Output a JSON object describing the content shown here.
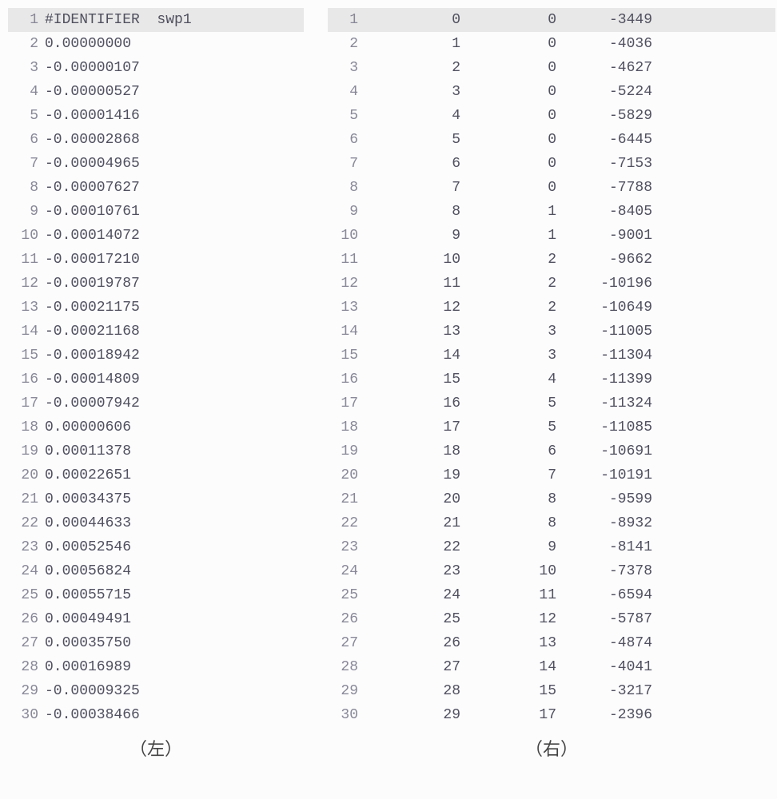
{
  "left_panel": {
    "rows": [
      {
        "n": "1",
        "v": "#IDENTIFIER  swp1",
        "hl": true
      },
      {
        "n": "2",
        "v": "0.00000000"
      },
      {
        "n": "3",
        "v": "-0.00000107"
      },
      {
        "n": "4",
        "v": "-0.00000527"
      },
      {
        "n": "5",
        "v": "-0.00001416"
      },
      {
        "n": "6",
        "v": "-0.00002868"
      },
      {
        "n": "7",
        "v": "-0.00004965"
      },
      {
        "n": "8",
        "v": "-0.00007627"
      },
      {
        "n": "9",
        "v": "-0.00010761"
      },
      {
        "n": "10",
        "v": "-0.00014072"
      },
      {
        "n": "11",
        "v": "-0.00017210"
      },
      {
        "n": "12",
        "v": "-0.00019787"
      },
      {
        "n": "13",
        "v": "-0.00021175"
      },
      {
        "n": "14",
        "v": "-0.00021168"
      },
      {
        "n": "15",
        "v": "-0.00018942"
      },
      {
        "n": "16",
        "v": "-0.00014809"
      },
      {
        "n": "17",
        "v": "-0.00007942"
      },
      {
        "n": "18",
        "v": "0.00000606"
      },
      {
        "n": "19",
        "v": "0.00011378"
      },
      {
        "n": "20",
        "v": "0.00022651"
      },
      {
        "n": "21",
        "v": "0.00034375"
      },
      {
        "n": "22",
        "v": "0.00044633"
      },
      {
        "n": "23",
        "v": "0.00052546"
      },
      {
        "n": "24",
        "v": "0.00056824"
      },
      {
        "n": "25",
        "v": "0.00055715"
      },
      {
        "n": "26",
        "v": "0.00049491"
      },
      {
        "n": "27",
        "v": "0.00035750"
      },
      {
        "n": "28",
        "v": "0.00016989"
      },
      {
        "n": "29",
        "v": "-0.00009325"
      },
      {
        "n": "30",
        "v": "-0.00038466"
      }
    ]
  },
  "right_panel": {
    "rows": [
      {
        "n": "1",
        "c1": "0",
        "c2": "0",
        "c3": "-3449",
        "hl": true
      },
      {
        "n": "2",
        "c1": "1",
        "c2": "0",
        "c3": "-4036"
      },
      {
        "n": "3",
        "c1": "2",
        "c2": "0",
        "c3": "-4627"
      },
      {
        "n": "4",
        "c1": "3",
        "c2": "0",
        "c3": "-5224"
      },
      {
        "n": "5",
        "c1": "4",
        "c2": "0",
        "c3": "-5829"
      },
      {
        "n": "6",
        "c1": "5",
        "c2": "0",
        "c3": "-6445"
      },
      {
        "n": "7",
        "c1": "6",
        "c2": "0",
        "c3": "-7153"
      },
      {
        "n": "8",
        "c1": "7",
        "c2": "0",
        "c3": "-7788"
      },
      {
        "n": "9",
        "c1": "8",
        "c2": "1",
        "c3": "-8405"
      },
      {
        "n": "10",
        "c1": "9",
        "c2": "1",
        "c3": "-9001"
      },
      {
        "n": "11",
        "c1": "10",
        "c2": "2",
        "c3": "-9662"
      },
      {
        "n": "12",
        "c1": "11",
        "c2": "2",
        "c3": "-10196"
      },
      {
        "n": "13",
        "c1": "12",
        "c2": "2",
        "c3": "-10649"
      },
      {
        "n": "14",
        "c1": "13",
        "c2": "3",
        "c3": "-11005"
      },
      {
        "n": "15",
        "c1": "14",
        "c2": "3",
        "c3": "-11304"
      },
      {
        "n": "16",
        "c1": "15",
        "c2": "4",
        "c3": "-11399"
      },
      {
        "n": "17",
        "c1": "16",
        "c2": "5",
        "c3": "-11324"
      },
      {
        "n": "18",
        "c1": "17",
        "c2": "5",
        "c3": "-11085"
      },
      {
        "n": "19",
        "c1": "18",
        "c2": "6",
        "c3": "-10691"
      },
      {
        "n": "20",
        "c1": "19",
        "c2": "7",
        "c3": "-10191"
      },
      {
        "n": "21",
        "c1": "20",
        "c2": "8",
        "c3": "-9599"
      },
      {
        "n": "22",
        "c1": "21",
        "c2": "8",
        "c3": "-8932"
      },
      {
        "n": "23",
        "c1": "22",
        "c2": "9",
        "c3": "-8141"
      },
      {
        "n": "24",
        "c1": "23",
        "c2": "10",
        "c3": "-7378"
      },
      {
        "n": "25",
        "c1": "24",
        "c2": "11",
        "c3": "-6594"
      },
      {
        "n": "26",
        "c1": "25",
        "c2": "12",
        "c3": "-5787"
      },
      {
        "n": "27",
        "c1": "26",
        "c2": "13",
        "c3": "-4874"
      },
      {
        "n": "28",
        "c1": "27",
        "c2": "14",
        "c3": "-4041"
      },
      {
        "n": "29",
        "c1": "28",
        "c2": "15",
        "c3": "-3217"
      },
      {
        "n": "30",
        "c1": "29",
        "c2": "17",
        "c3": "-2396"
      }
    ]
  },
  "labels": {
    "left": "（左）",
    "right": "（右）"
  }
}
